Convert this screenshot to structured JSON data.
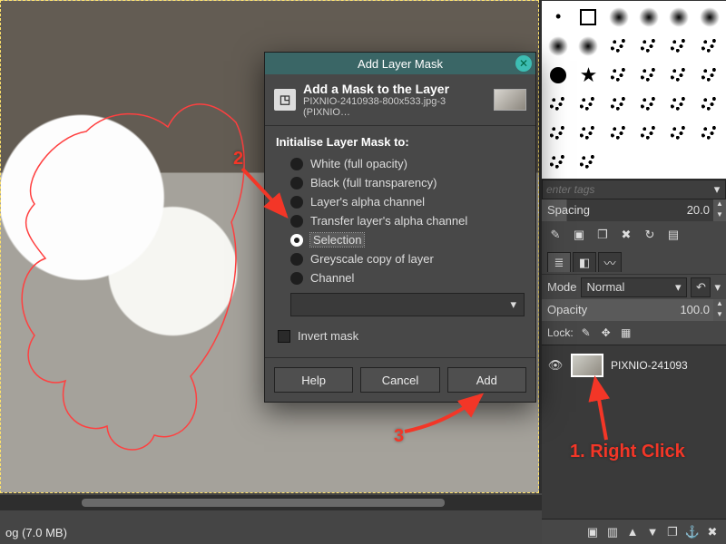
{
  "status_bar": "og (7.0 MB)",
  "brush_panel": {
    "tags_placeholder": "enter tags",
    "spacing_label": "Spacing",
    "spacing_value": "20.0"
  },
  "layer_panel": {
    "mode_label": "Mode",
    "mode_value": "Normal",
    "opacity_label": "Opacity",
    "opacity_value": "100.0",
    "lock_label": "Lock:",
    "layer_name": "PIXNIO-241093"
  },
  "dialog": {
    "title": "Add Layer Mask",
    "heading": "Add a Mask to the Layer",
    "subheading": "PIXNIO-2410938-800x533.jpg-3 (PIXNIO…",
    "group_label": "Initialise Layer Mask to:",
    "options": {
      "white": "White (full opacity)",
      "black": "Black (full transparency)",
      "alpha": "Layer's alpha channel",
      "transfer": "Transfer layer's alpha channel",
      "selection": "Selection",
      "greyscale": "Greyscale copy of layer",
      "channel": "Channel"
    },
    "invert": "Invert mask",
    "buttons": {
      "help": "Help",
      "cancel": "Cancel",
      "add": "Add"
    }
  },
  "annotations": {
    "one": "1. Right Click",
    "two": "2",
    "three": "3"
  }
}
